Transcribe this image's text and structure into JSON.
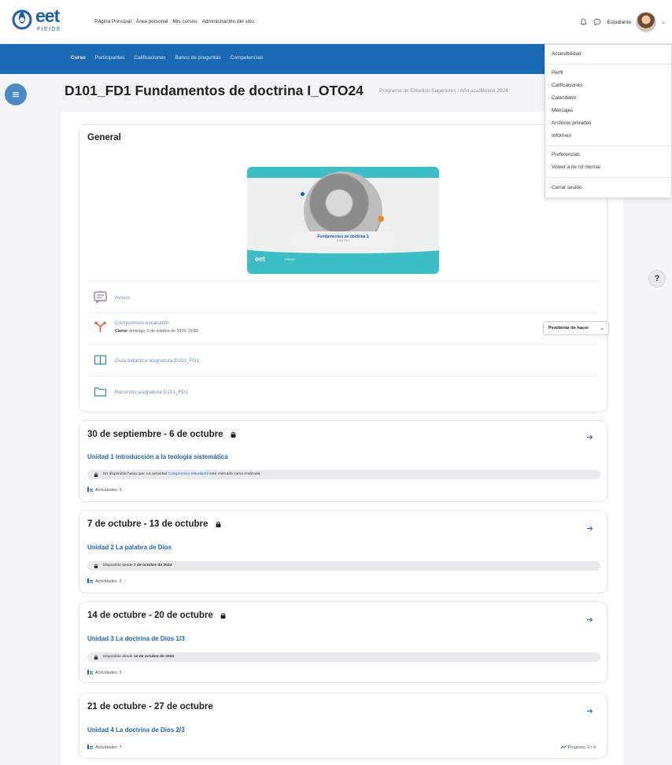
{
  "header": {
    "logo_text": "eet",
    "logo_sub": "FIEIDE",
    "nav": [
      "Página Principal",
      "Área personal",
      "Mis cursos",
      "Administración del sitio"
    ],
    "user_name": "Estudiante"
  },
  "course_nav": {
    "items": [
      "Curso",
      "Participantes",
      "Calificaciones",
      "Banco de preguntas",
      "Competencias"
    ],
    "active": 0
  },
  "page": {
    "title": "D101_FD1 Fundamentos de doctrina I_OTO24",
    "breadcrumb": "Programa de Estudios Superiores / Año académico 2024"
  },
  "general": {
    "title": "General",
    "banner": {
      "label": "Fundamentos de doctrina 1",
      "sublabel": "D101 FD1",
      "logo": "eet",
      "logo_sub": "FIEIDE"
    },
    "activities": [
      {
        "name": "Avisos",
        "icon": "forum-icon"
      },
      {
        "name": "Compromiso estudiantil",
        "icon": "choice-icon",
        "sub_label": "Cierra:",
        "sub_value": "domingo, 6 de octubre de 2024, 23:59",
        "status": "Pendiente de hacer"
      },
      {
        "name": "Guía didáctica asignatura D101_FD1",
        "icon": "book-icon"
      },
      {
        "name": "Recursos asignatura D101_FD1",
        "icon": "folder-icon"
      }
    ]
  },
  "sections": [
    {
      "title": "30 de septiembre - 6 de octubre",
      "locked": true,
      "unit": "Unidad 1 Introducción a la teología sistemática",
      "restriction_pre": "No disponible hasta que: La actividad ",
      "restriction_link": "Compromiso estudiantil",
      "restriction_post": " esté marcada como realizada",
      "activities": "Actividades: 3"
    },
    {
      "title": "7 de octubre - 13 de octubre",
      "locked": true,
      "unit": "Unidad 2 La palabra de Dios",
      "restriction_pre": "Disponible desde ",
      "restriction_bold": "7 de octubre de 2024",
      "activities": "Actividades: 3"
    },
    {
      "title": "14 de octubre - 20 de octubre",
      "locked": true,
      "unit": "Unidad 3 La doctrina de Dios 1/3",
      "restriction_pre": "Disponible desde ",
      "restriction_bold": "14 de octubre de 2024",
      "activities": "Actividades: 3"
    },
    {
      "title": "21 de octubre - 27 de octubre",
      "locked": false,
      "unit": "Unidad 4 La doctrina de Dios 2/3",
      "activities": "Actividades: 7",
      "progress": "Progreso: 0 / 4"
    }
  ],
  "user_menu": {
    "items": [
      "Accesibilidad",
      "Perfil",
      "Calificaciones",
      "Calendario",
      "Mensajes",
      "Archivos privados",
      "Informes",
      "Preferencias",
      "Volver a mi rol normal",
      "Cerrar sesión"
    ]
  },
  "help_label": "?",
  "colors": {
    "primary": "#1a69b5",
    "accent": "#3cbec6",
    "orange": "#f08a1c"
  }
}
